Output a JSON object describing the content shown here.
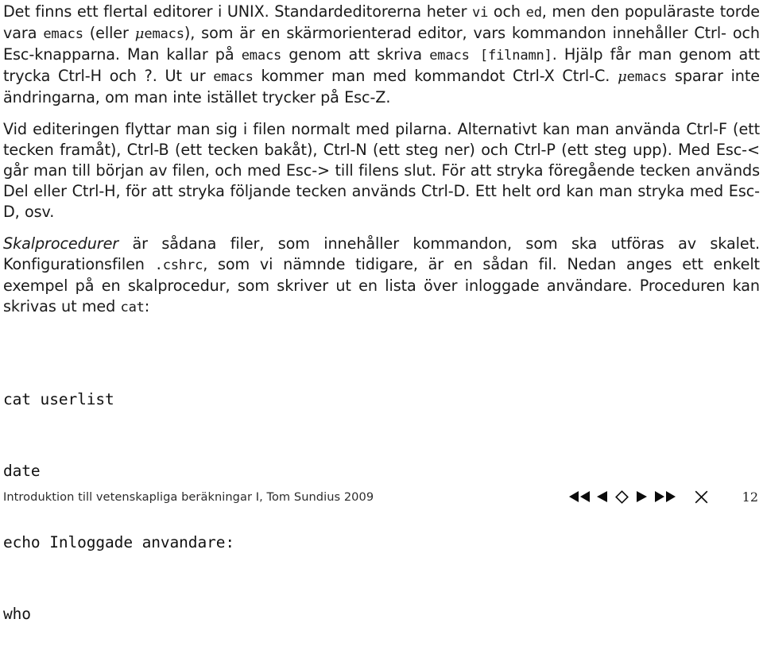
{
  "document": {
    "type": "lecture-slide",
    "language": "sv",
    "page_number": "12"
  },
  "content": {
    "paragraph1": {
      "s1": "Det finns ett flertal editorer i UNIX. Standardeditorerna heter ",
      "code1": "vi",
      "s2": " och ",
      "code2": "ed",
      "s3": ", men den populäraste torde vara ",
      "code3": "emacs",
      "s4": " (eller ",
      "mu": "μ",
      "code4": "emacs",
      "s5": "), som är en skärmorienterad editor, vars kommandon innehåller Ctrl- och Esc-knapparna. Man kallar på ",
      "code5": "emacs",
      "s6": " genom att skriva ",
      "code6": "emacs [filnamn]",
      "s7": ". Hjälp får man genom att trycka Ctrl-H och ?. Ut ur ",
      "code7": "emacs",
      "s8": " kommer man med kommandot Ctrl-X Ctrl-C. ",
      "mu2": "μ",
      "code8": "emacs",
      "s9": " sparar inte ändringarna, om man inte istället trycker på Esc-Z."
    },
    "paragraph2": {
      "s1": "Vid editeringen flyttar man sig i filen normalt med pilarna. Alternativt kan man använda Ctrl-F (ett tecken framåt), Ctrl-B (ett tecken bakåt), Ctrl-N (ett steg ner) och Ctrl-P (ett steg upp). Med Esc-< går man till början av filen, och med Esc-> till filens slut. För att stryka föregående tecken används Del eller Ctrl-H, för att stryka följande tecken används Ctrl-D. Ett helt ord kan man stryka med Esc-D, osv."
    },
    "paragraph3": {
      "italic1": "Skalprocedurer",
      "s1": " är sådana filer, som innehåller kommandon, som ska utföras av skalet. Konfigurationsfilen ",
      "code1": ".cshrc",
      "s2": ", som vi nämnde tidigare, är en sådan fil. Nedan anges ett enkelt exempel på en skalprocedur, som skriver ut en lista över inloggade användare. Proceduren kan skrivas ut med ",
      "code2": "cat",
      "s3": ":"
    },
    "code_block": {
      "lines": [
        "cat userlist",
        "date",
        "echo Inloggade anvandare:",
        "who"
      ]
    }
  },
  "footer": {
    "attribution": "Introduktion till vetenskapliga beräkningar I, Tom Sundius 2009",
    "page_number": "12",
    "nav": {
      "first_label": "first-slide",
      "prev_label": "previous-slide",
      "home_label": "home",
      "next_label": "next-slide",
      "last_label": "last-slide",
      "close_label": "close"
    }
  },
  "colors": {
    "background": "#ffffff",
    "text": "#1a1a1a",
    "footer_text": "#2b2b2b",
    "nav_icon": "#0b0b0b"
  }
}
